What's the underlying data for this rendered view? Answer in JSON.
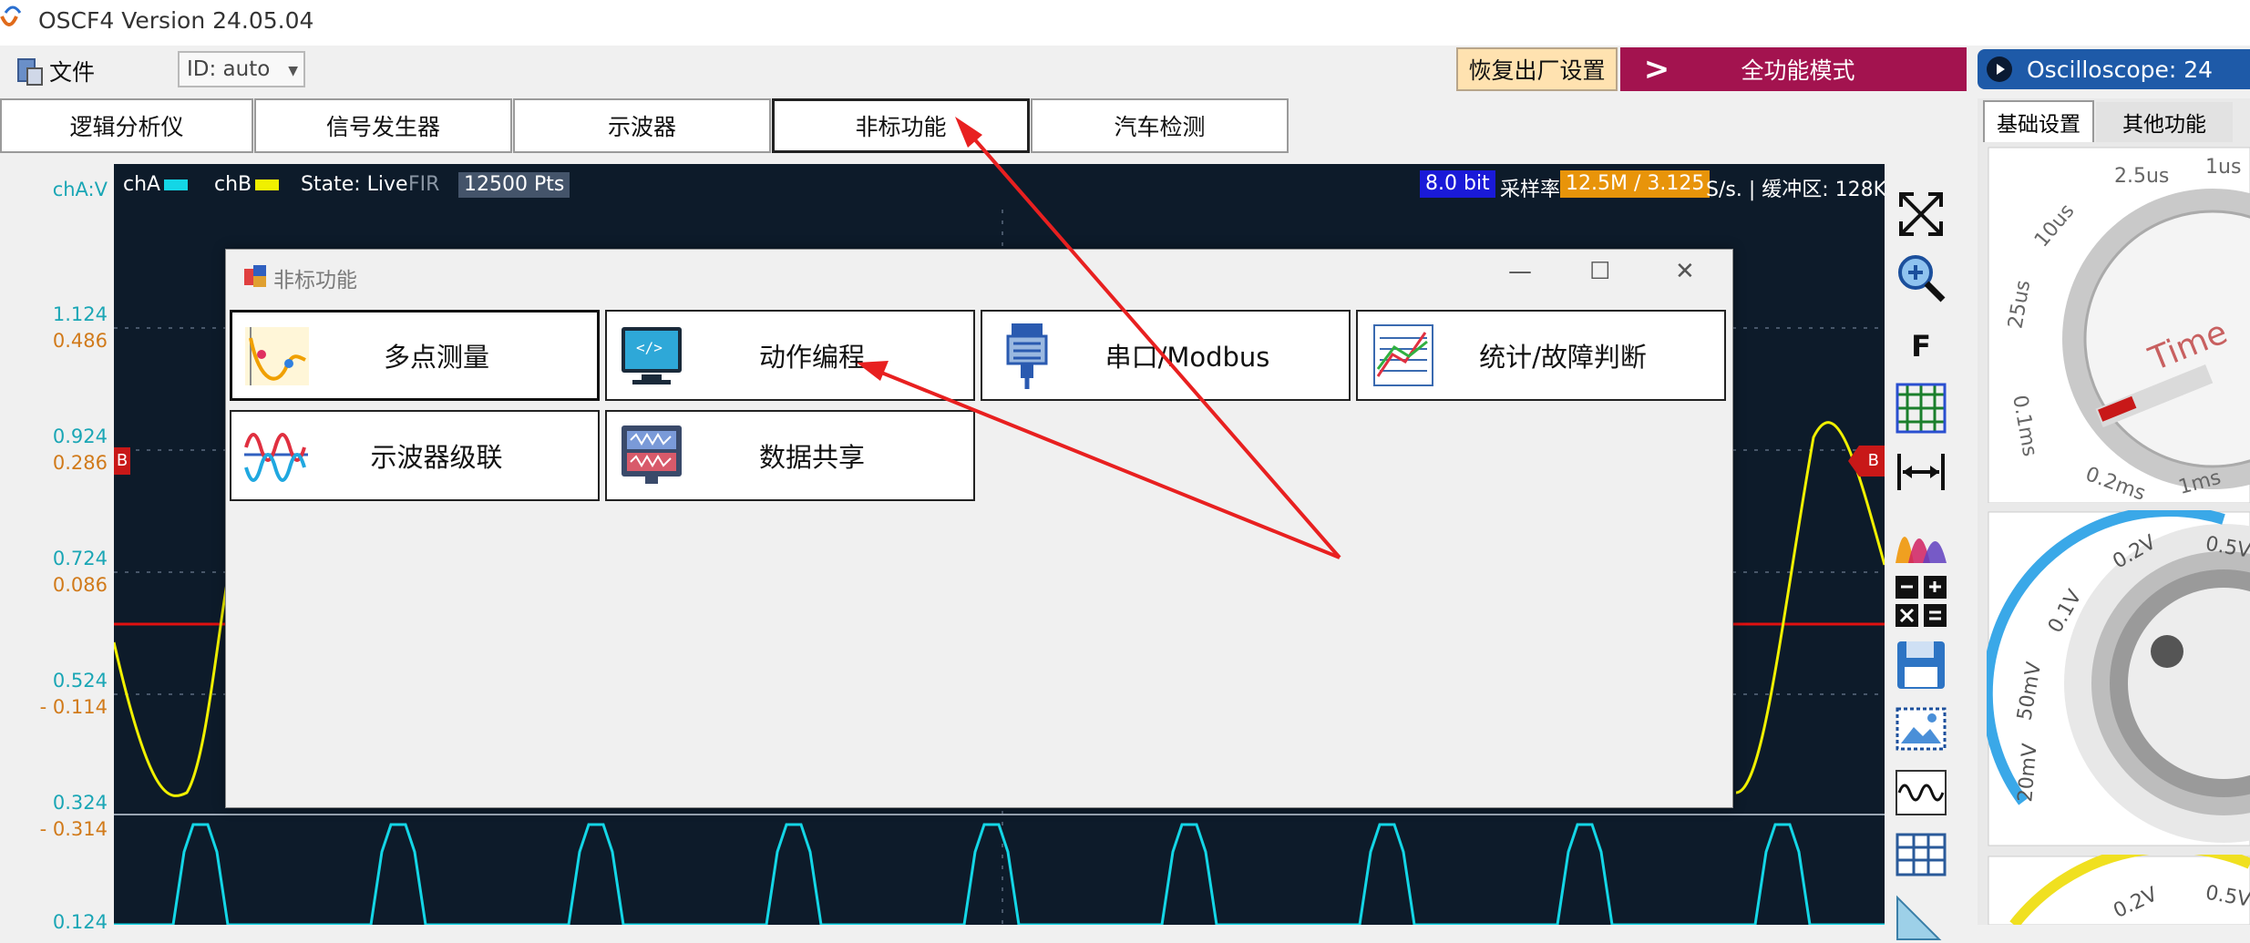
{
  "app": {
    "title": "OSCF4  Version 24.05.04"
  },
  "menu": {
    "file": "文件",
    "id_select": "ID: auto",
    "reset": "恢复出厂设置",
    "mode_arrow": ">",
    "mode": "全功能模式",
    "osc": "Oscilloscope: 24"
  },
  "tabs": [
    {
      "label": "逻辑分析仪"
    },
    {
      "label": "信号发生器"
    },
    {
      "label": "示波器"
    },
    {
      "label": "非标功能"
    },
    {
      "label": "汽车检测"
    }
  ],
  "scope": {
    "axis_unit": "chA:V",
    "cha": "chA",
    "chb": "chB",
    "state": "State: Live",
    "fir": "FIR",
    "points": "12500 Pts",
    "bits": "8.0 bit",
    "rate_label": "采样率",
    "rate": "12.5M / 3.125",
    "rate_rest": "S/s. | 缓冲区: 128K.",
    "marker": "B",
    "cha_color": "#14d6e6",
    "chb_color": "#f0f000",
    "y_a": [
      "1.124",
      "0.924",
      "0.724",
      "0.524",
      "0.324",
      "0.124"
    ],
    "y_b": [
      "0.486",
      "0.286",
      "0.086",
      "- 0.114",
      "- 0.314"
    ]
  },
  "right_panel": {
    "tab1": "基础设置",
    "tab2": "其他功能",
    "time_knob": "Time",
    "time_labels": [
      "2.5us",
      "1us",
      "10us",
      "25us",
      "0.1ms",
      "0.2ms",
      "1ms"
    ],
    "volt_labels": [
      "0.2V",
      "0.5V",
      "0.1V",
      "50mV",
      "20mV"
    ],
    "volt_labels2": [
      "0.2V",
      "0.5V"
    ]
  },
  "toolbar": {
    "f_label": "F"
  },
  "dialog": {
    "title": "非标功能",
    "minimize": "—",
    "maximize": "☐",
    "close": "✕",
    "buttons": [
      {
        "label": "多点测量",
        "icon": "multipoint-icon"
      },
      {
        "label": "动作编程",
        "icon": "code-monitor-icon"
      },
      {
        "label": "串口/Modbus",
        "icon": "serial-connector-icon"
      },
      {
        "label": "统计/故障判断",
        "icon": "statistics-chart-icon"
      },
      {
        "label": "示波器级联",
        "icon": "cascade-waves-icon"
      },
      {
        "label": "数据共享",
        "icon": "data-share-icon"
      }
    ]
  }
}
